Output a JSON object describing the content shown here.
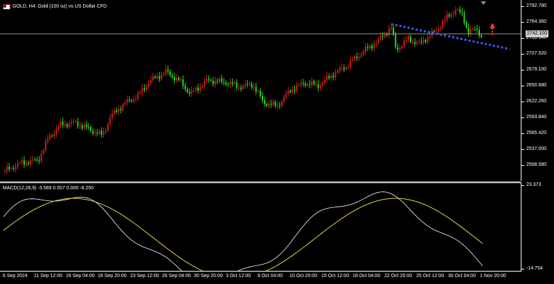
{
  "chart": {
    "title": "GOLD, H4:  Gold (100 oz) vs US Dollar CFD",
    "symbol_flag_icon": "us-flag-icon",
    "bull_color": "#cc1f1f",
    "bear_color": "#22dd22",
    "trendline_color": "#3b5bff",
    "arrow_color": "#ff3333"
  },
  "price_axis": {
    "labels": [
      "2792.780",
      "2764.360",
      "2735.940",
      "2707.520",
      "2679.100",
      "2650.680",
      "2622.260",
      "2593.840",
      "2565.420",
      "2537.000",
      "2508.580"
    ],
    "current_price": "2742.100"
  },
  "indicator": {
    "title": "MACD(12,26,9) -3.569 0.557 0.000 -8.250",
    "axis_labels": [
      "23.373",
      "-14.754"
    ],
    "signal_color": "#e8d84a",
    "macd_line_color": "#ffffff",
    "positive_hist_color": "#b22a2a",
    "negative_hist_color": "#3aa6b8"
  },
  "time_axis": {
    "labels": [
      "6 Sep 2024",
      "11 Sep 12:00",
      "16 Sep 04:00",
      "18 Sep 20:00",
      "23 Sep 12:00",
      "26 Sep 04:00",
      "30 Sep 20:00",
      "3 Oct 12:00",
      "8 Oct 04:00",
      "10 Oct 20:00",
      "15 Oct 12:00",
      "18 Oct 04:00",
      "22 Oct 20:00",
      "25 Oct 12:00",
      "30 Oct 04:00",
      "1 Nov 20:00"
    ]
  }
}
